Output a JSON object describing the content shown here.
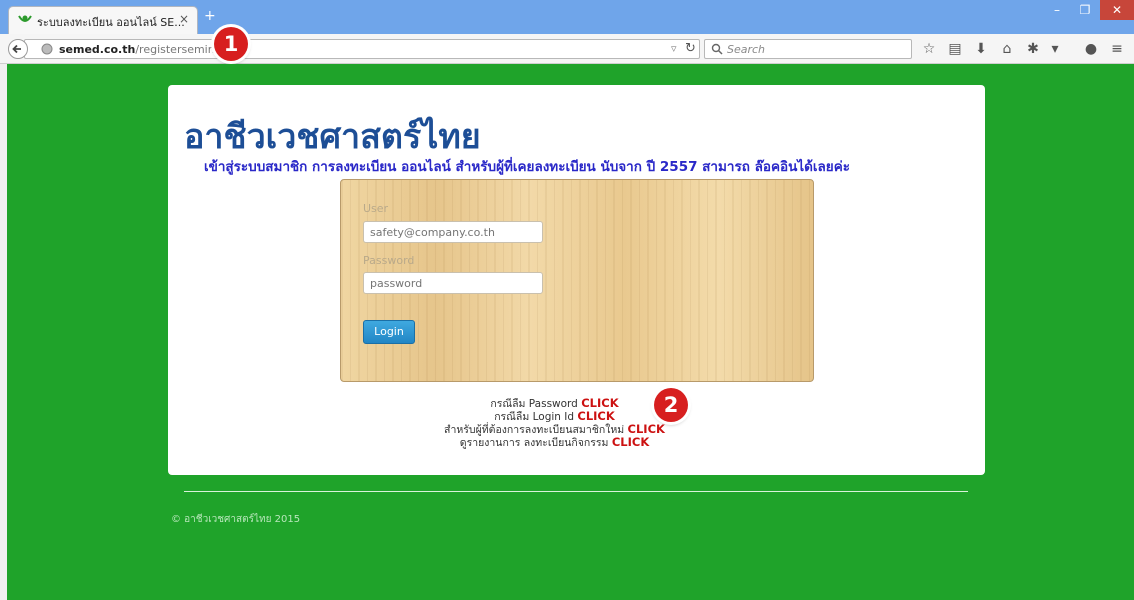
{
  "browser": {
    "tab_title": "ระบบลงทะเบียน ออนไลน์ SE...",
    "url_host": "semed.co.th",
    "url_path": "/registerseminar",
    "search_placeholder": "Search",
    "window_controls": [
      "–",
      "❐",
      "✕"
    ]
  },
  "markers": [
    "1",
    "2"
  ],
  "page": {
    "title": "อาชีวเวชศาสตร์ไทย",
    "subtitle": "เข้าสู่ระบบสมาชิก การลงทะเบียน ออนไลน์ สำหรับผู้ที่เคยลงทะเบียน นับจาก ปี 2557 สามารถ ล๊อคอินได้เลยค่ะ",
    "login": {
      "user_label": "User",
      "user_placeholder": "safety@company.co.th",
      "password_label": "Password",
      "password_placeholder": "password",
      "button_label": "Login"
    },
    "links": [
      {
        "text": "กรณีลืม Password",
        "action": "CLICK"
      },
      {
        "text": "กรณีลืม Login Id",
        "action": "CLICK"
      },
      {
        "text": "สำหรับผู้ที่ต้องการลงทะเบียนสมาชิกใหม่",
        "action": "CLICK"
      },
      {
        "text": "ดูรายงานการ ลงทะเบียนกิจกรรม",
        "action": "CLICK"
      }
    ],
    "footer": "© อาชีวเวชศาสตร์ไทย 2015"
  },
  "colors": {
    "page_background": "#1fa32a",
    "title": "#1d4e96",
    "subtitle": "#2a28c8",
    "click_link": "#cc1111",
    "marker": "#d71f1f"
  },
  "icons": [
    "favicon-leaf-icon",
    "close-icon",
    "plus-icon",
    "back-arrow-icon",
    "globe-icon",
    "dropdown-icon",
    "reload-icon",
    "search-icon",
    "star-icon",
    "reading-list-icon",
    "download-icon",
    "home-icon",
    "share-icon",
    "chat-icon",
    "menu-icon"
  ]
}
